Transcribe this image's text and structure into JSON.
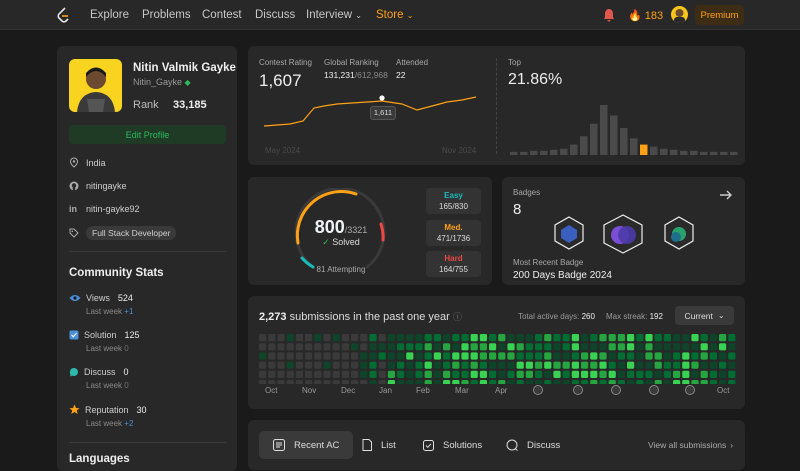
{
  "nav": {
    "links": [
      "Explore",
      "Problems",
      "Contest",
      "Discuss",
      "Interview",
      "Store"
    ],
    "streak": "183",
    "premium": "Premium"
  },
  "profile": {
    "name": "Nitin Valmik Gayke",
    "username": "Nitin_Gayke",
    "rank_label": "Rank",
    "rank_value": "33,185",
    "edit_label": "Edit Profile",
    "location": "India",
    "github": "nitingayke",
    "linkedin": "nitin-gayke92",
    "skill": "Full Stack Developer"
  },
  "community": {
    "title": "Community Stats",
    "stats": [
      {
        "label": "Views",
        "value": "524",
        "last": "Last week",
        "delta": "+1",
        "color": "#4a8fd9"
      },
      {
        "label": "Solution",
        "value": "125",
        "last": "Last week",
        "delta": "0",
        "color": "#4a8fd9"
      },
      {
        "label": "Discuss",
        "value": "0",
        "last": "Last week",
        "delta": "0",
        "color": "#2cbbab"
      },
      {
        "label": "Reputation",
        "value": "30",
        "last": "Last week",
        "delta": "+2",
        "color": "#ffa116"
      }
    ]
  },
  "languages_title": "Languages",
  "contest": {
    "rating_label": "Contest Rating",
    "rating": "1,607",
    "global_label": "Global Ranking",
    "global": "131,231",
    "global_total": "/612,968",
    "attended_label": "Attended",
    "attended": "22",
    "tooltip": "1,611",
    "x_start": "May 2024",
    "x_end": "Nov 2024",
    "top_label": "Top",
    "top": "21.86%",
    "histogram": [
      3,
      3,
      4,
      4,
      5,
      6,
      10,
      18,
      30,
      48,
      38,
      26,
      16,
      10,
      8,
      6,
      5,
      4,
      4,
      3,
      3,
      3,
      3
    ],
    "highlight_index": 13
  },
  "solved": {
    "count": "800",
    "total": "/3321",
    "label": "Solved",
    "attempting": "81 Attempting",
    "easy_label": "Easy",
    "easy": "165/830",
    "medium_label": "Med.",
    "medium": "471/1736",
    "hard_label": "Hard",
    "hard": "164/755"
  },
  "badges": {
    "label": "Badges",
    "count": "8",
    "recent_label": "Most Recent Badge",
    "recent": "200 Days Badge 2024"
  },
  "calendar": {
    "count": "2,273",
    "text": "submissions in the past one year",
    "active_label": "Total active days:",
    "active": "260",
    "streak_label": "Max streak:",
    "streak": "192",
    "selector": "Current",
    "months": [
      "Oct",
      "Nov",
      "Dec",
      "Jan",
      "Feb",
      "Mar",
      "Apr",
      "",
      "",
      "",
      "",
      "",
      "Oct"
    ]
  },
  "tabs": {
    "recent": "Recent AC",
    "list": "List",
    "solutions": "Solutions",
    "discuss": "Discuss",
    "view_all": "View all submissions"
  },
  "colors": {
    "green": "#2cbb5d",
    "orange": "#ffa116",
    "red": "#ef4743",
    "teal": "#1cbaba"
  }
}
